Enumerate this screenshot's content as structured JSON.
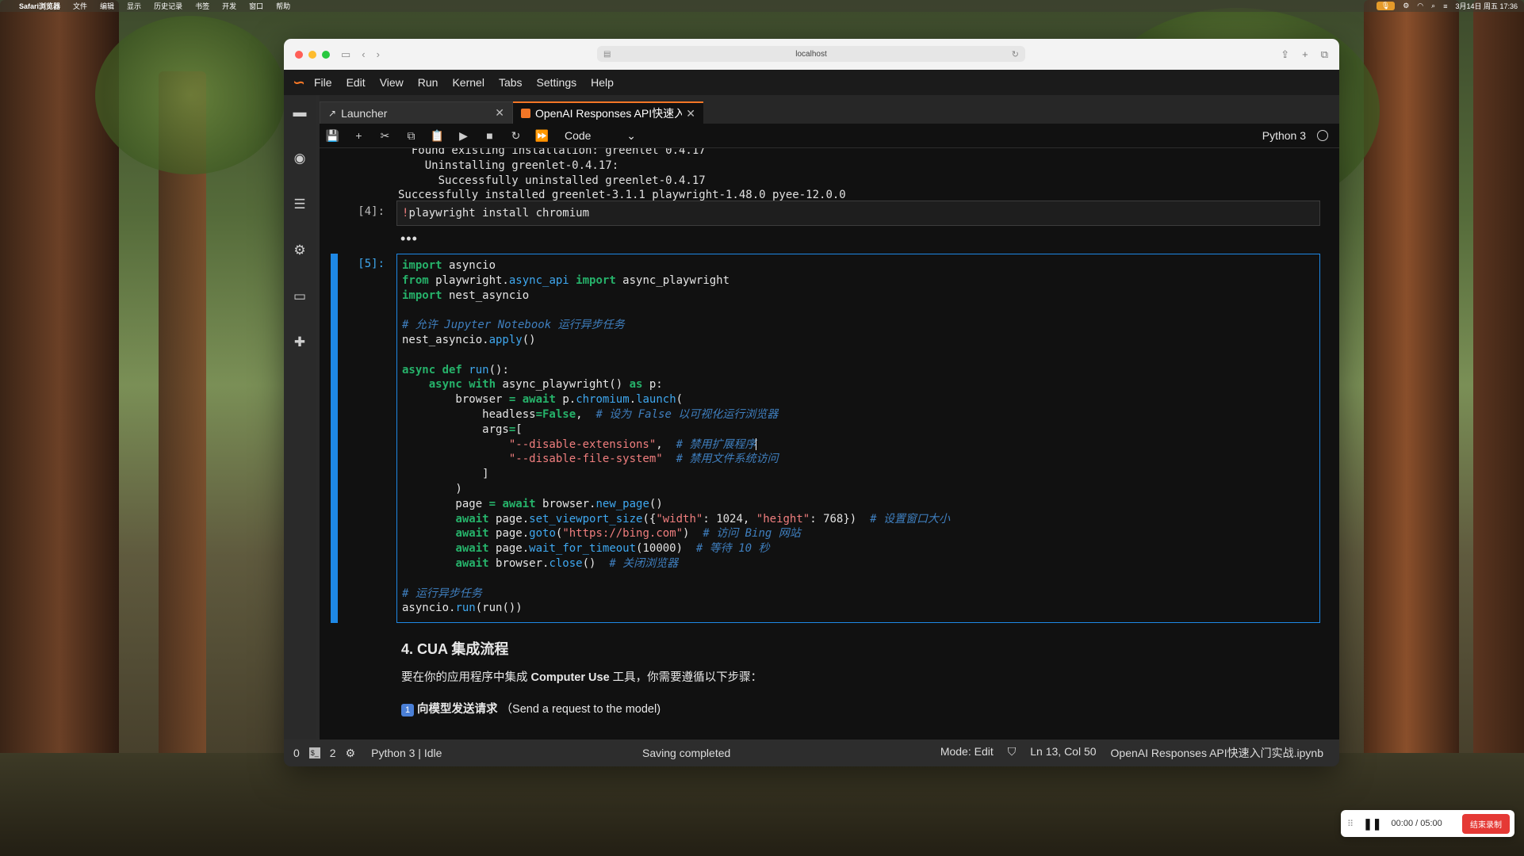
{
  "menubar": {
    "app": "Safari浏览器",
    "items": [
      "文件",
      "编辑",
      "显示",
      "历史记录",
      "书签",
      "开发",
      "窗口",
      "帮助"
    ],
    "datetime": "3月14日 周五 17:36"
  },
  "browser": {
    "url": "localhost"
  },
  "jupyter_menu": [
    "File",
    "Edit",
    "View",
    "Run",
    "Kernel",
    "Tabs",
    "Settings",
    "Help"
  ],
  "tabs": [
    {
      "label": "Launcher",
      "active": false
    },
    {
      "label": "OpenAI Responses API快速入",
      "active": true
    }
  ],
  "toolbar": {
    "cell_type": "Code",
    "kernel": "Python 3"
  },
  "output_lines": [
    "  Found existing installation: greenlet 0.4.17",
    "    Uninstalling greenlet-0.4.17:",
    "      Successfully uninstalled greenlet-0.4.17",
    "Successfully installed greenlet-3.1.1 playwright-1.48.0 pyee-12.0.0"
  ],
  "cell4": {
    "prompt": "[4]:",
    "bang": "!",
    "code": "playwright install chromium",
    "output": "•••"
  },
  "cell5": {
    "prompt": "[5]:"
  },
  "markdown": {
    "heading": "4. CUA 集成流程",
    "intro_pre": "要在你的应用程序中集成 ",
    "intro_bold": "Computer Use",
    "intro_post": " 工具，你需要遵循以下步骤：",
    "step_num": "1",
    "step_bold": "向模型发送请求",
    "step_rest": "（Send a request to the model)"
  },
  "status": {
    "left_count_a": "0",
    "left_count_b": "2",
    "kernel_state": "Python 3 | Idle",
    "message": "Saving completed",
    "mode": "Mode: Edit",
    "position": "Ln 13, Col 50",
    "filename": "OpenAI Responses API快速入门实战.ipynb"
  },
  "recorder": {
    "time": "00:00  /  05:00",
    "stop_label": "结束录制"
  },
  "colors": {
    "accent": "#f37626",
    "active_cell": "#1e88e5",
    "keyword": "#26b26a",
    "string": "#f07e7e",
    "comment": "#3f7fbf"
  }
}
